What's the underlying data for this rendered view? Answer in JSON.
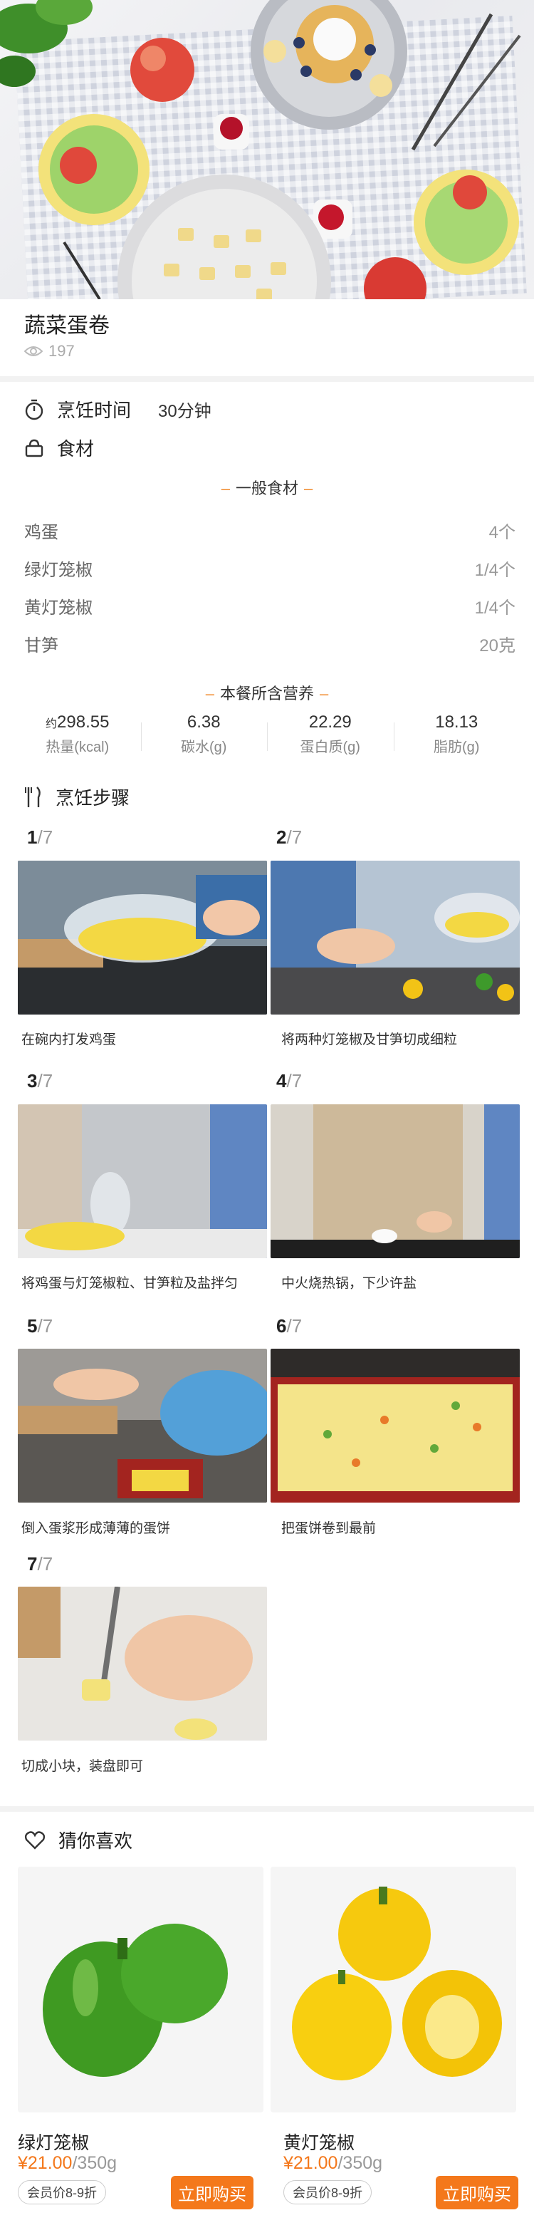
{
  "recipe": {
    "title": "蔬菜蛋卷",
    "views": "197",
    "cook_time_label": "烹饪时间",
    "cook_time_value": "30分钟",
    "ingredients_label": "食材",
    "general_ingredients_label": "一般食材",
    "ingredients": [
      {
        "name": "鸡蛋",
        "amount": "4个"
      },
      {
        "name": "绿灯笼椒",
        "amount": "1/4个"
      },
      {
        "name": "黄灯笼椒",
        "amount": "1/4个"
      },
      {
        "name": "甘笋",
        "amount": "20克"
      }
    ],
    "nutrition_label": "本餐所含营养",
    "nutrition": [
      {
        "prefix": "约",
        "value": "298.55",
        "label": "热量(kcal)"
      },
      {
        "prefix": "",
        "value": "6.38",
        "label": "碳水(g)"
      },
      {
        "prefix": "",
        "value": "22.29",
        "label": "蛋白质(g)"
      },
      {
        "prefix": "",
        "value": "18.13",
        "label": "脂肪(g)"
      }
    ],
    "steps_label": "烹饪步骤",
    "steps_total": "/7",
    "steps": [
      {
        "num": "1",
        "caption": "在碗内打发鸡蛋"
      },
      {
        "num": "2",
        "caption": "将两种灯笼椒及甘笋切成细粒"
      },
      {
        "num": "3",
        "caption": "将鸡蛋与灯笼椒粒、甘笋粒及盐拌匀"
      },
      {
        "num": "4",
        "caption": "中火烧热锅，下少许盐"
      },
      {
        "num": "5",
        "caption": "倒入蛋浆形成薄薄的蛋饼"
      },
      {
        "num": "6",
        "caption": "把蛋饼卷到最前"
      },
      {
        "num": "7",
        "caption": "切成小块，装盘即可"
      }
    ]
  },
  "recommend": {
    "label": "猜你喜欢",
    "items": [
      {
        "name": "绿灯笼椒",
        "price": "¥21.00",
        "unit": "/350g",
        "vip": "会员价8-9折",
        "buy": "立即购买"
      },
      {
        "name": "黄灯笼椒",
        "price": "¥21.00",
        "unit": "/350g",
        "vip": "会员价8-9折",
        "buy": "立即购买"
      }
    ]
  },
  "colors": {
    "accent": "#f4781b",
    "dash": "#f08a2b"
  }
}
